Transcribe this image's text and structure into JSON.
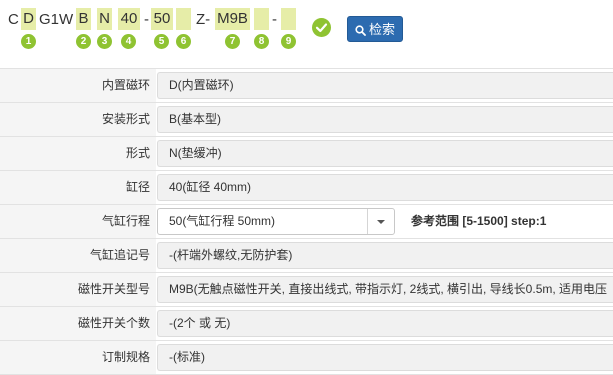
{
  "code": {
    "prefix": "C",
    "seg1": "D",
    "mid1": "G1W",
    "seg2": "B",
    "seg3": "N",
    "seg4": "40",
    "dash1": "-",
    "seg5": "50",
    "seg6": "",
    "mid2": "Z-",
    "seg7": "M9B",
    "seg8": "",
    "dash2": "-",
    "seg9": "",
    "markers": [
      "1",
      "2",
      "3",
      "4",
      "5",
      "6",
      "7",
      "8",
      "9"
    ]
  },
  "search_button": {
    "label": "检索",
    "icon": "search-icon"
  },
  "status_icon": "check-circle-icon",
  "rows": [
    {
      "label": "内置磁环",
      "value": "D(内置磁环)"
    },
    {
      "label": "安装形式",
      "value": "B(基本型)"
    },
    {
      "label": "形式",
      "value": "N(垫缓冲)"
    },
    {
      "label": "缸径",
      "value": "40(缸径 40mm)"
    },
    {
      "label": "气缸行程",
      "value": "50(气缸行程 50mm)",
      "range": "参考范围 [5-1500] step:1"
    },
    {
      "label": "气缸追记号",
      "value": "-(杆端外螺纹,无防护套)"
    },
    {
      "label": "磁性开关型号",
      "value": "M9B(无触点磁性开关, 直接出线式, 带指示灯, 2线式, 横引出, 导线长0.5m, 适用电压"
    },
    {
      "label": "磁性开关个数",
      "value": "-(2个 或 无)"
    },
    {
      "label": "订制规格",
      "value": "-(标准)"
    }
  ],
  "colors": {
    "accent_green": "#8fc332",
    "box_fill": "#e6eda8",
    "button_blue": "#2c6bb0"
  }
}
